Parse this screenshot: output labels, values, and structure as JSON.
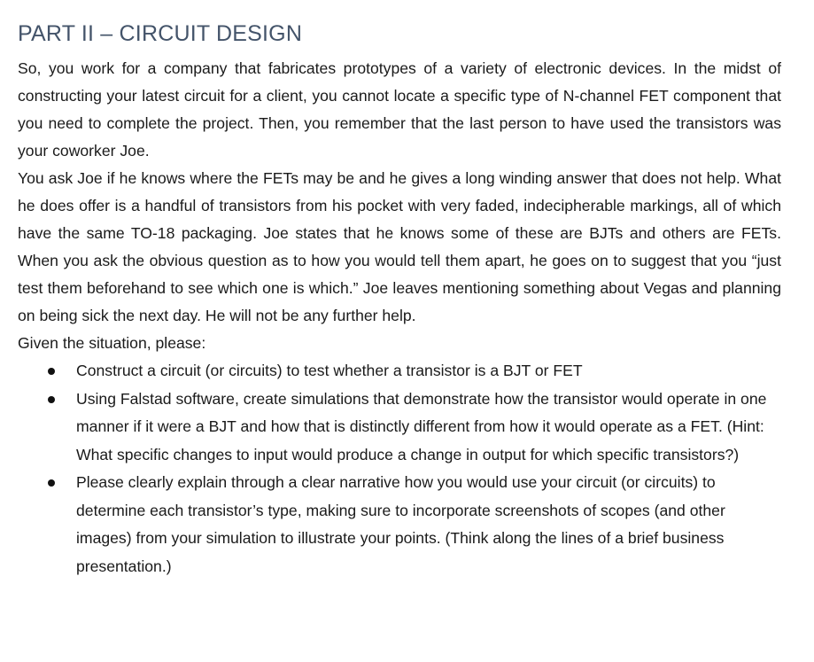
{
  "document": {
    "title": "PART II – CIRCUIT DESIGN",
    "paragraphs": [
      "So, you work for a company that fabricates prototypes of a variety of electronic devices. In the midst of constructing your latest circuit for a client, you cannot locate a specific type of N-channel FET component that you need to complete the project. Then, you remember that the last person to have used the transistors was your coworker Joe.",
      "You ask Joe if he knows where the FETs may be and he gives a long winding answer that does not help. What he does offer is a handful of transistors from his pocket with very faded, indecipherable markings, all of which have the same TO-18 packaging. Joe states that he knows some of these are BJTs and others are FETs. When you ask the obvious question as to how you would tell them apart, he goes on to suggest that you “just test them beforehand to see which one is which.” Joe leaves mentioning something about Vegas and planning on being sick the next day. He will not be any further help."
    ],
    "intro": "Given the situation, please:",
    "bullets": [
      "Construct a circuit (or circuits) to test whether a transistor is a BJT or FET",
      "Using Falstad software, create simulations that demonstrate how the transistor would operate in one manner if it were a BJT and how that is distinctly different from how it would operate as a FET. (Hint: What specific changes to input would produce a change in output for which specific transistors?)",
      "Please clearly explain through a clear narrative how you would use your circuit (or circuits) to determine each transistor’s type, making sure to incorporate screenshots of scopes (and other images) from your simulation to illustrate your points. (Think along the lines of a brief business presentation.)"
    ]
  },
  "colors": {
    "title": "#44546a",
    "body_text": "#1a1a1a",
    "background": "#ffffff"
  }
}
